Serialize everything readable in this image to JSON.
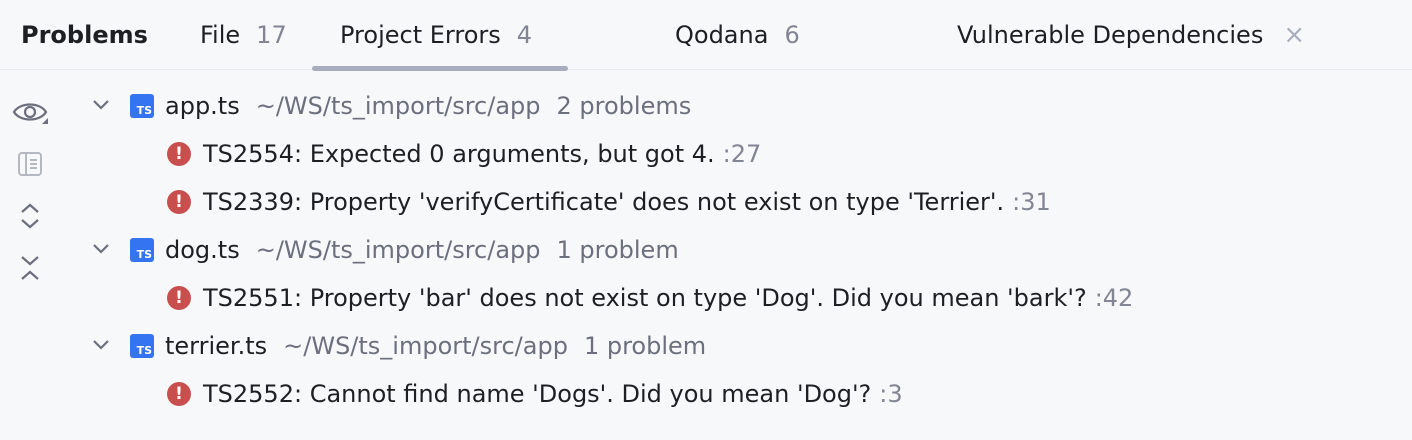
{
  "tabs": {
    "title": "Problems",
    "items": [
      {
        "label": "File",
        "count": "17"
      },
      {
        "label": "Project Errors",
        "count": "4"
      },
      {
        "label": "Qodana",
        "count": "6"
      },
      {
        "label": "Vulnerable Dependencies",
        "close": "×"
      }
    ]
  },
  "toolbar": {
    "icons": [
      "eye-icon",
      "preview-icon",
      "expand-all-icon",
      "collapse-all-icon"
    ]
  },
  "files": [
    {
      "badge": "TS",
      "name": "app.ts",
      "path": "~/WS/ts_import/src/app",
      "count": "2 problems",
      "problems": [
        {
          "text": "TS2554: Expected 0 arguments, but got 4.",
          "loc": ":27"
        },
        {
          "text": "TS2339: Property 'verifyCertificate' does not exist on type 'Terrier'.",
          "loc": ":31"
        }
      ]
    },
    {
      "badge": "TS",
      "name": "dog.ts",
      "path": "~/WS/ts_import/src/app",
      "count": "1 problem",
      "problems": [
        {
          "text": "TS2551: Property 'bar' does not exist on type 'Dog'. Did you mean 'bark'?",
          "loc": ":42"
        }
      ]
    },
    {
      "badge": "TS",
      "name": "terrier.ts",
      "path": "~/WS/ts_import/src/app",
      "count": "1 problem",
      "problems": [
        {
          "text": "TS2552: Cannot find name 'Dogs'. Did you mean 'Dog'?",
          "loc": ":3"
        }
      ]
    }
  ],
  "colors": {
    "background": "#f7f8fa",
    "error": "#c94f4f",
    "ts_badge": "#3574f0",
    "muted": "#6c707e"
  }
}
